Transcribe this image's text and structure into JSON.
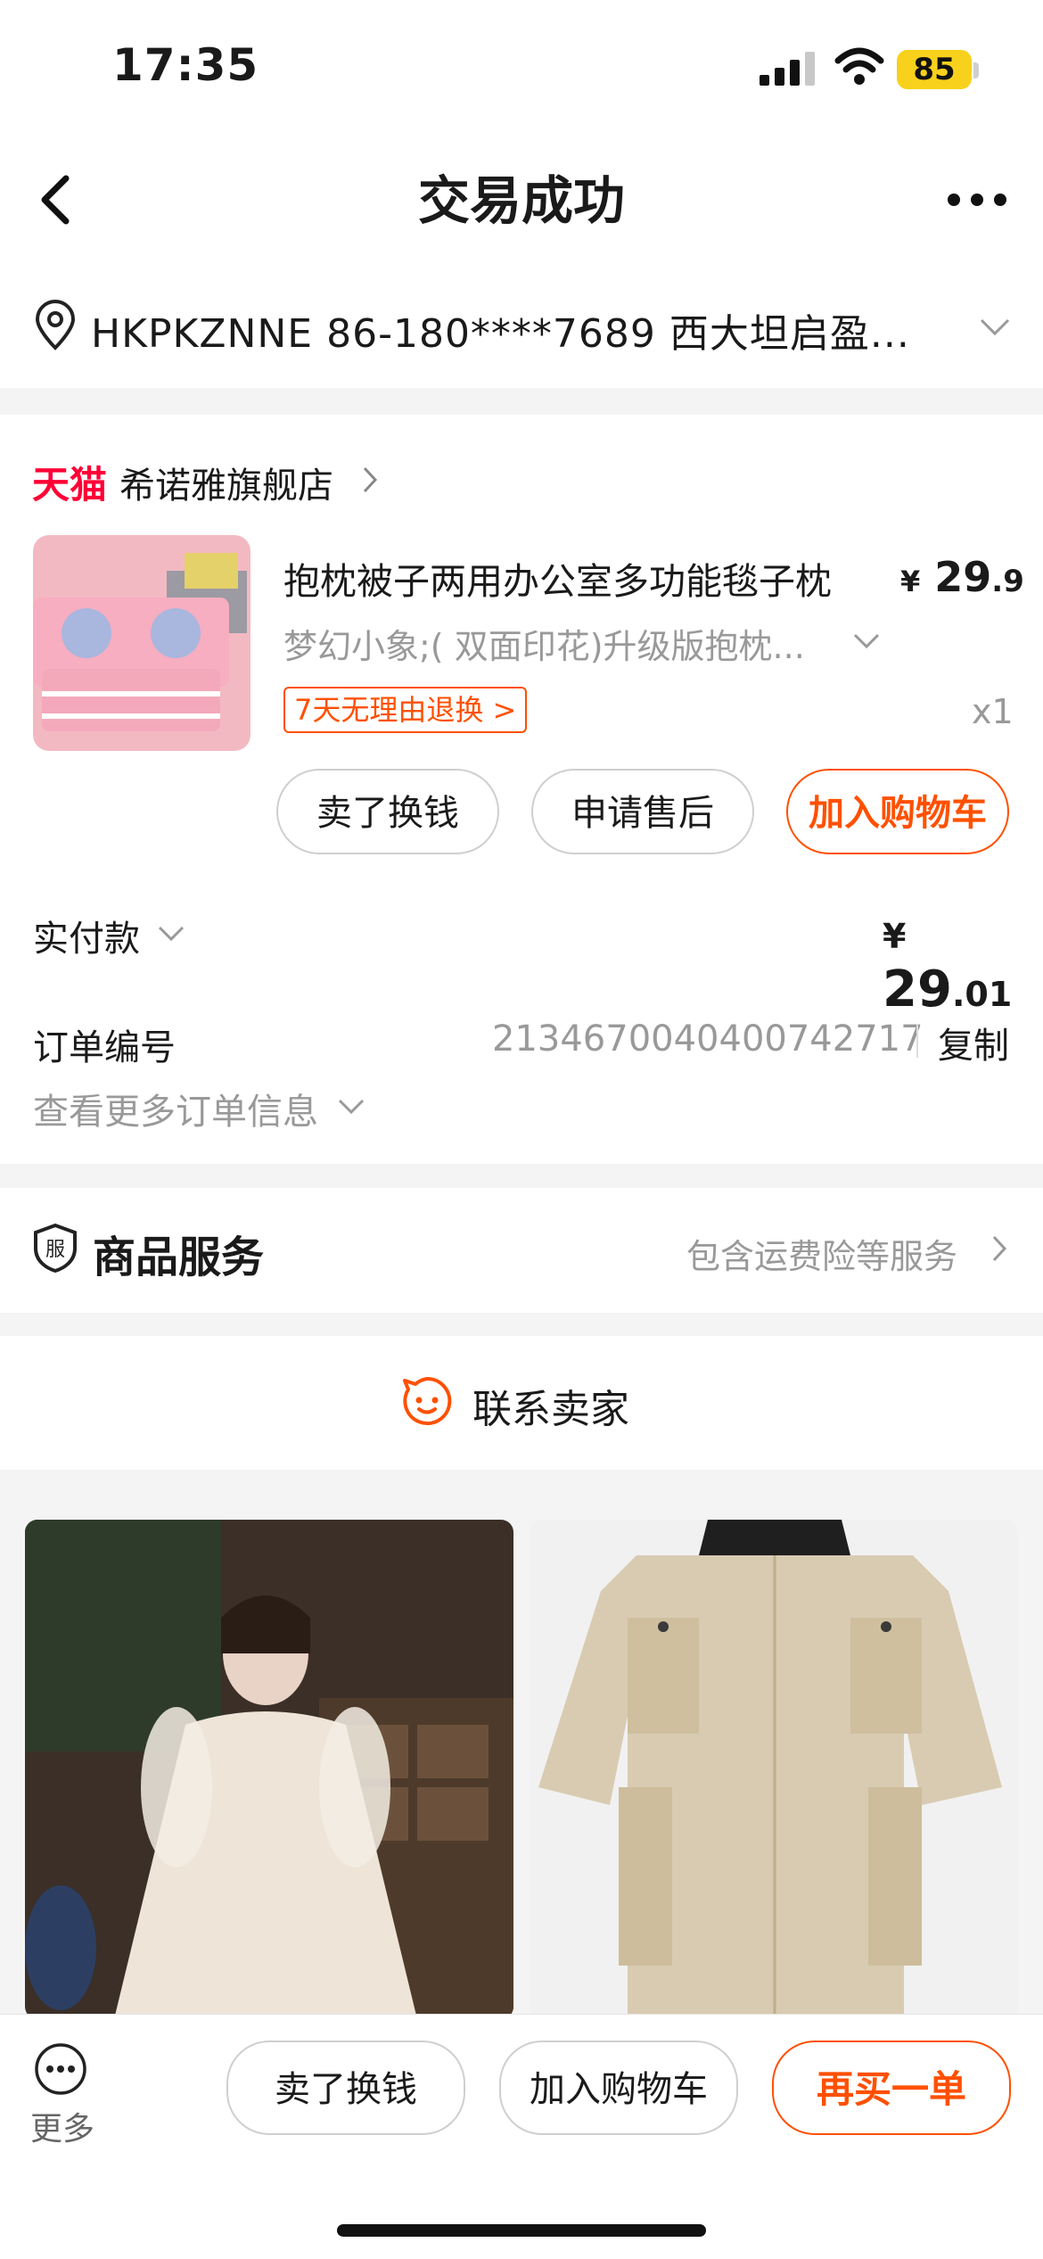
{
  "status_bar": {
    "time": "17:35",
    "battery": "85"
  },
  "nav": {
    "title": "交易成功"
  },
  "address": {
    "text": "HKPKZNNE 86-180****7689 西大坦启盈..."
  },
  "store": {
    "platform_logo": "天猫",
    "name": "希诺雅旗舰店"
  },
  "product": {
    "title": "抱枕被子两用办公室多功能毯子枕",
    "price_symbol": "¥",
    "price_int": "29",
    "price_dec": ".9",
    "spec": "梦幻小象;( 双面印花)升级版抱枕...",
    "return_policy": "7天无理由退换 >",
    "quantity": "x1"
  },
  "actions": {
    "sell": "卖了换钱",
    "after_sale": "申请售后",
    "add_cart": "加入购物车"
  },
  "payment": {
    "label": "实付款",
    "symbol": "¥",
    "amount_int": "29",
    "amount_dec": ".01"
  },
  "order": {
    "no_label": "订单编号",
    "no_value": "2134670040400742717",
    "copy": "复制",
    "more_info": "查看更多订单信息"
  },
  "service": {
    "title": "商品服务",
    "desc": "包含运费险等服务"
  },
  "contact": {
    "label": "联系卖家"
  },
  "bottom_bar": {
    "more": "更多",
    "sell": "卖了换钱",
    "add_cart": "加入购物车",
    "rebuy": "再买一单"
  },
  "colors": {
    "accent": "#ff5000",
    "tmall": "#ff0036",
    "battery": "#f7d11b"
  },
  "icons": [
    "signal-icon",
    "wifi-icon",
    "battery-icon",
    "back-icon",
    "more-icon",
    "location-icon",
    "chevron-down-icon",
    "chevron-right-icon",
    "service-shield-icon",
    "contact-seller-icon",
    "more-menu-icon"
  ]
}
